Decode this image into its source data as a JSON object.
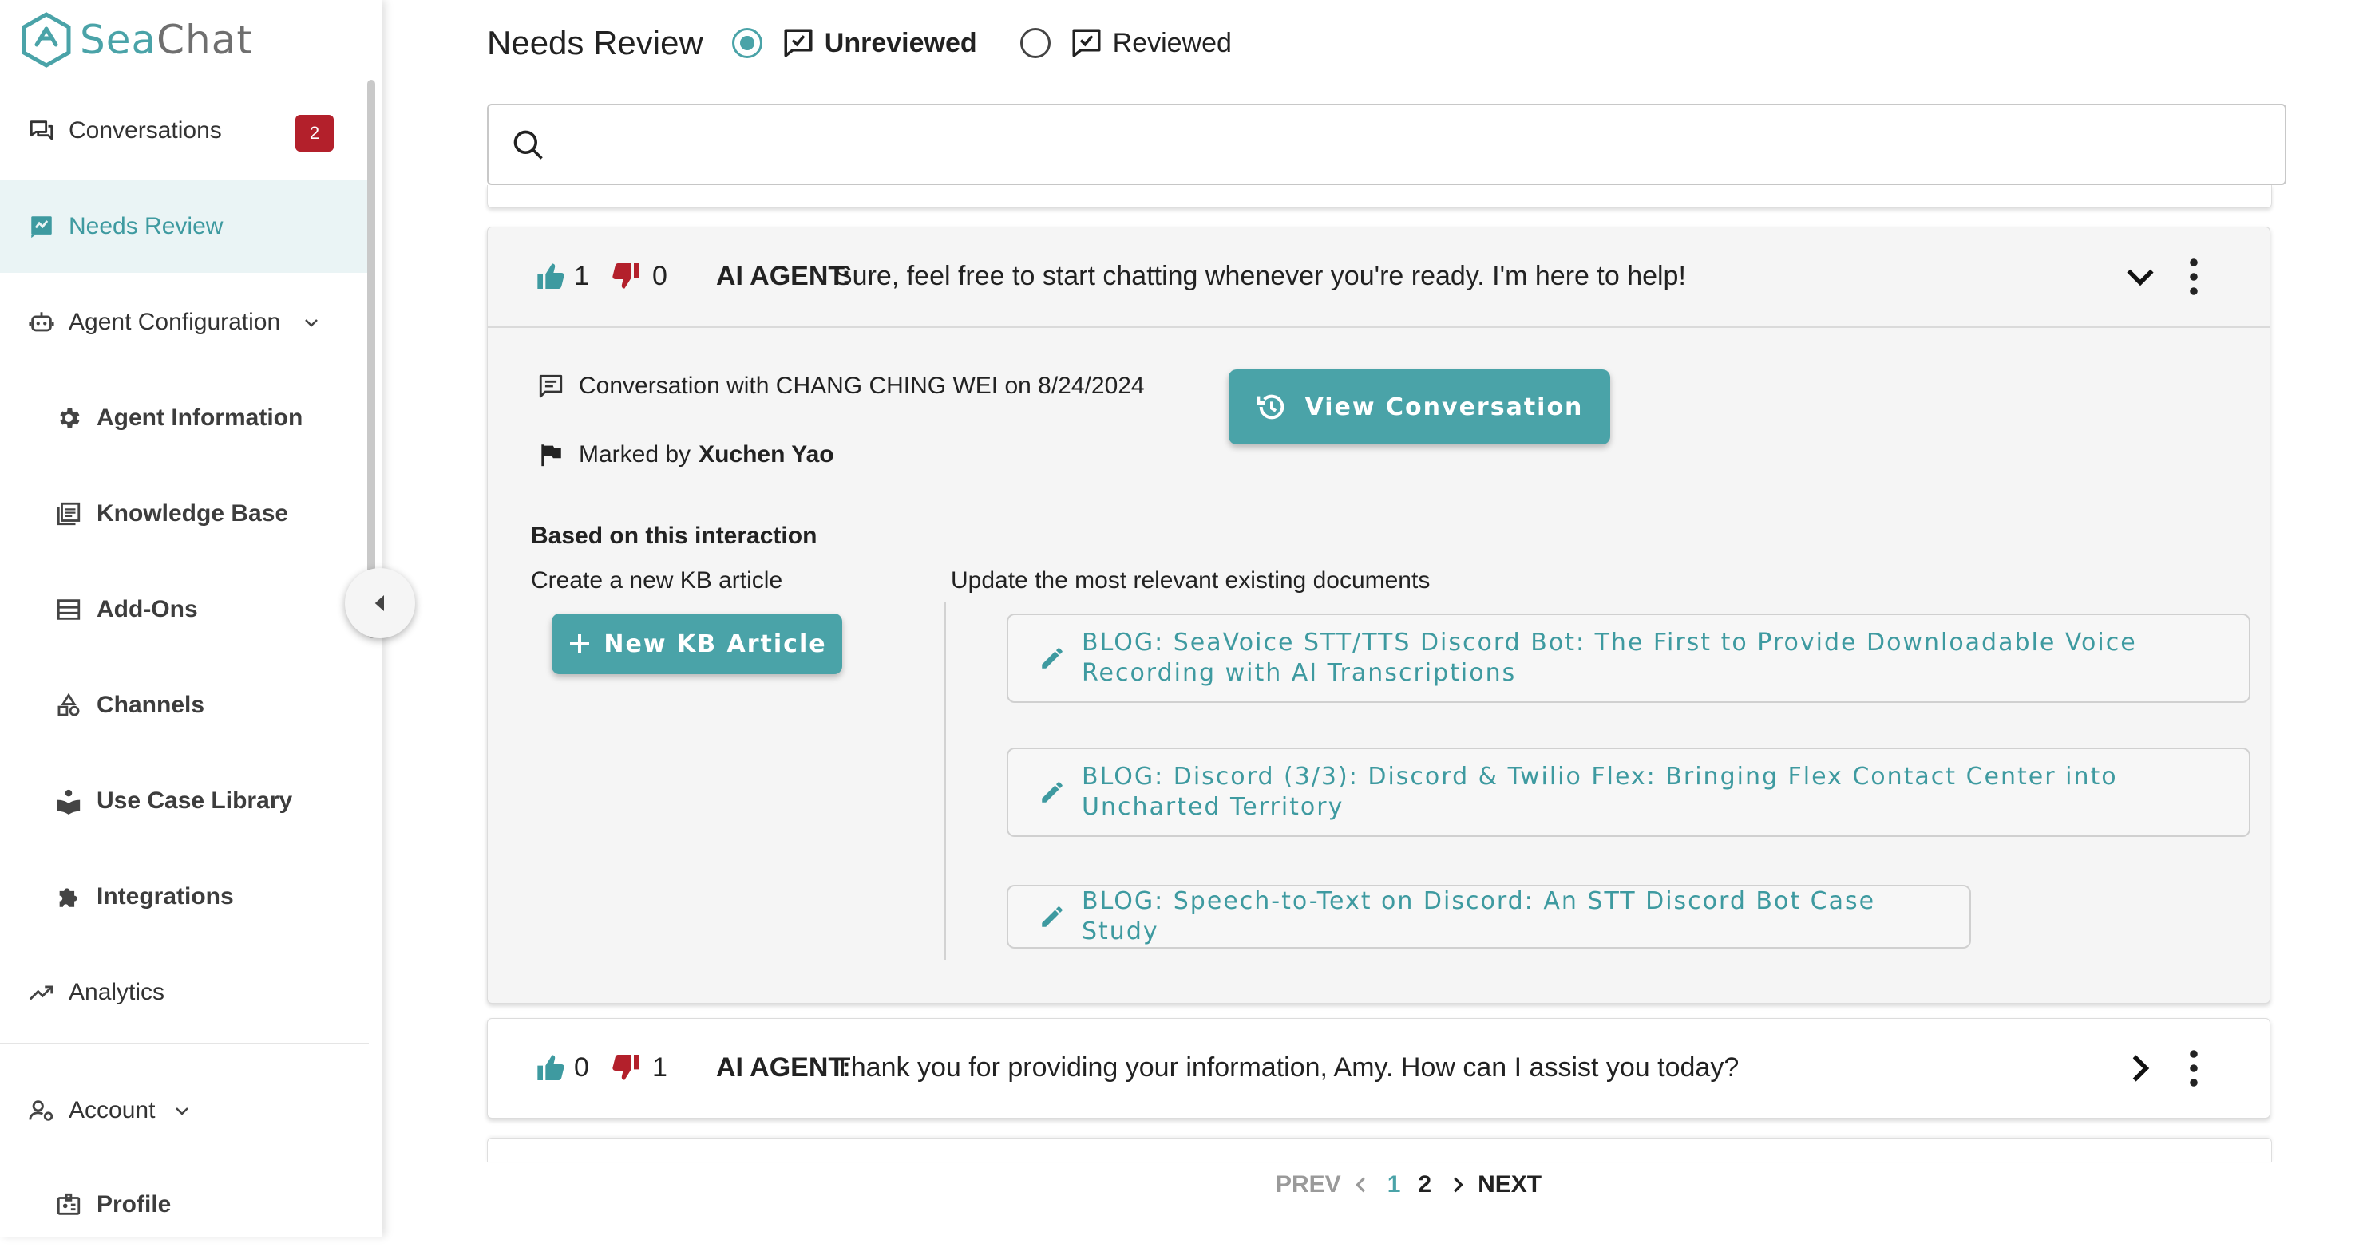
{
  "app": {
    "logo_sea": "Sea",
    "logo_chat": "Chat"
  },
  "colors": {
    "accent": "#4aa3a8",
    "badge": "#b3202b",
    "thumb_up": "#3e9aa0",
    "thumb_down": "#b3202b"
  },
  "sidebar": {
    "conversations": {
      "label": "Conversations",
      "badge": "2"
    },
    "needs_review": {
      "label": "Needs Review"
    },
    "agent_configuration": {
      "label": "Agent Configuration"
    },
    "agent_information": {
      "label": "Agent Information"
    },
    "knowledge_base": {
      "label": "Knowledge Base"
    },
    "add_ons": {
      "label": "Add-Ons"
    },
    "channels": {
      "label": "Channels"
    },
    "use_case_library": {
      "label": "Use Case Library"
    },
    "integrations": {
      "label": "Integrations"
    },
    "analytics": {
      "label": "Analytics"
    },
    "account": {
      "label": "Account"
    },
    "profile": {
      "label": "Profile"
    }
  },
  "header": {
    "title": "Needs Review",
    "filters": {
      "unreviewed": "Unreviewed",
      "reviewed": "Reviewed",
      "selected": "Unreviewed"
    }
  },
  "search": {
    "value": "",
    "placeholder": ""
  },
  "reviews": [
    {
      "up": "1",
      "down": "0",
      "agent_label": "AI AGENT:",
      "message": "Sure, feel free to start chatting whenever you're ready. I'm here to help!",
      "expanded": true,
      "conversation_text": "Conversation with CHANG CHING WEI on 8/24/2024",
      "marked_prefix": "Marked by",
      "marked_by": "Xuchen Yao",
      "view_button": "View Conversation",
      "based_on": "Based on this interaction",
      "create_label": "Create a new KB article",
      "new_kb_button": "New KB Article",
      "update_label": "Update the most relevant existing documents",
      "documents": [
        "BLOG: SeaVoice STT/TTS Discord Bot: The First to Provide Downloadable Voice Recording with AI Transcriptions",
        "BLOG: Discord (3/3): Discord & Twilio Flex: Bringing Flex Contact Center into Uncharted Territory",
        "BLOG: Speech-to-Text on Discord: An STT Discord Bot Case Study"
      ]
    },
    {
      "up": "0",
      "down": "1",
      "agent_label": "AI AGENT:",
      "message": "Thank you for providing your information, Amy. How can I assist you today?",
      "expanded": false
    }
  ],
  "pagination": {
    "prev": "PREV",
    "pages": [
      "1",
      "2"
    ],
    "current": "1",
    "next": "NEXT"
  }
}
